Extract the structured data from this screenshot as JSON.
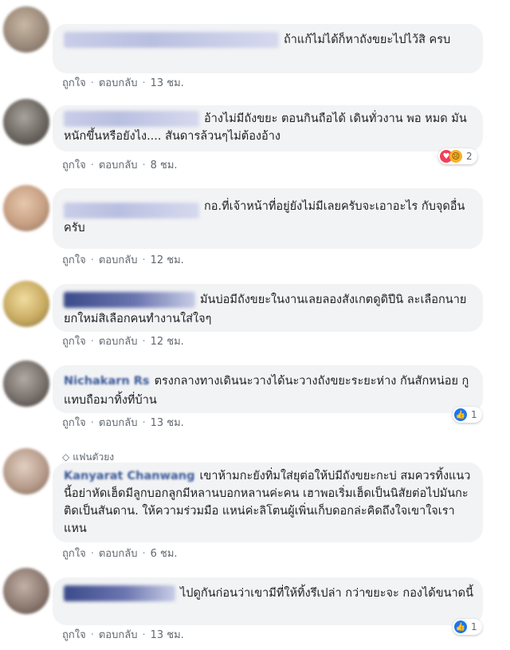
{
  "actions": {
    "like": "ถูกใจ",
    "reply": "ตอบกลับ"
  },
  "comments": [
    {
      "text": "ถ้าแก้ไม่ได้ก็หาถังขยะไปไว้สิ ครบ",
      "time": "13 ชม."
    },
    {
      "text": "อ้างไม่มีถังขยะ ตอนกินถือได้ เดินทั่วงาน พอ หมด มันหนักขึ้นหรือยังไง.... สันดารล้วนๆไม่ต้องอ้าง",
      "time": "8 ชม.",
      "reaction_count": "2"
    },
    {
      "text": "กอ.ที่เจ้าหน้าที่อยู่ยังไม่มีเลยครับจะเอาอะไร กับจุดอื่นครับ",
      "time": "12 ชม."
    },
    {
      "text": "มันบ่อมีถังขยะในงานเลยลองสังเกตดูดิปีนิ ละเลือกนายยกใหม่สิเลือกคนทำงานใส่ใจๆ",
      "time": "12 ชม."
    },
    {
      "name": "Nichakarn Rs",
      "text": "ตรงกลางทางเดินนะวางได้นะวางถังขยะระยะห่าง กันสักหน่อย กูแทบถือมาทิ้งที่บ้าน",
      "time": "13 ชม.",
      "reaction_count": "1"
    },
    {
      "badge": "แฟนตัวยง",
      "name": "Kanyarat Chanwang",
      "text": "เขาห้ามกะยังทิ่มใส่ยุต่อให้บ่มีถังขยะกะบ่ สมควรทิ้งแนวนี้อย่าหัดเฮ็ดมีลูกบอกลูกมีหลานบอกหลานค่ะคน เฮาพอเริ่มเฮ็ดเป็นนิสัยต่อไปมันกะติดเป็นสันดาน. ให้ความร่วมมือ แหน่ค่ะลิโตนผู้เพิ่นเก็บดอกล่ะคิดถึงใจเขาใจเราแหน",
      "time": "6 ชม."
    },
    {
      "text": "ไปดูกันก่อนว่าเขามีที่ให้ทิ้งรึเปล่า กว่าขยะจะ กองได้ขนาดนี้",
      "time": "13 ชม.",
      "reaction_count": "1"
    }
  ]
}
